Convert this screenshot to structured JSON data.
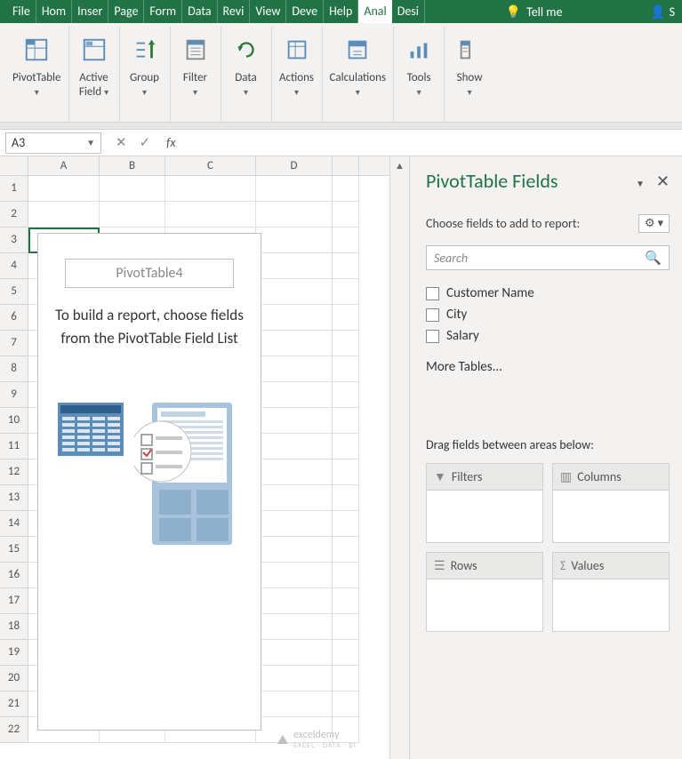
{
  "tabs": {
    "file": "File",
    "home": "Hom",
    "insert": "Inser",
    "page": "Page",
    "formulas": "Form",
    "data": "Data",
    "review": "Revi",
    "view": "View",
    "developer": "Deve",
    "help": "Help",
    "analyze": "Anal",
    "design": "Desi",
    "tellme": "Tell me",
    "share": "S"
  },
  "ribbon": {
    "pivottable": "PivotTable",
    "activefield": "Active\nField",
    "group": "Group",
    "filter": "Filter",
    "data": "Data",
    "actions": "Actions",
    "calculations": "Calculations",
    "tools": "Tools",
    "show": "Show"
  },
  "namebox": "A3",
  "fx": "fx",
  "columns": [
    "A",
    "B",
    "C",
    "D"
  ],
  "rows": [
    1,
    2,
    3,
    4,
    5,
    6,
    7,
    8,
    9,
    10,
    11,
    12,
    13,
    14,
    15,
    16,
    17,
    18,
    19,
    20,
    21,
    22
  ],
  "pivot_placeholder": {
    "title": "PivotTable4",
    "instruction": "To build a report, choose fields from the PivotTable Field List"
  },
  "fields_pane": {
    "title": "PivotTable Fields",
    "choose": "Choose fields to add to report:",
    "search_placeholder": "Search",
    "fields": [
      "Customer Name",
      "City",
      "Salary"
    ],
    "more_tables": "More Tables...",
    "drag_label": "Drag fields between areas below:",
    "areas": {
      "filters": "Filters",
      "columns": "Columns",
      "rows": "Rows",
      "values": "Values"
    }
  },
  "watermark": {
    "brand": "exceldemy",
    "sub": "EXCEL · DATA · BI"
  }
}
